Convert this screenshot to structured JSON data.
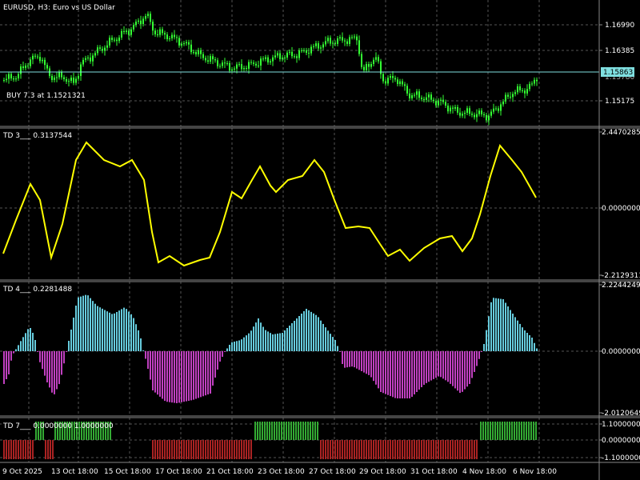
{
  "main": {
    "title": "EURUSD, H3:  Euro vs US Dollar",
    "trade_label": "BUY 7.3 at 1.1521321",
    "price_axis": [
      "1.16990",
      "1.16385",
      "1.15175"
    ],
    "current_price": "1.15863",
    "current_price_behind": "1.15780"
  },
  "td3": {
    "title": "TD 3___  0.3137544",
    "axis": [
      "2.4470285",
      "0.0000000",
      "-2.2129311"
    ]
  },
  "td4": {
    "title": "TD 4___  0.2281488",
    "axis": [
      "2.2244249",
      "0.0000000",
      "-2.0120649"
    ]
  },
  "td7": {
    "title": "TD 7___  0.0000000  1.0000000",
    "axis": [
      "1.1000000",
      "0.0000000",
      "-1.1000000"
    ]
  },
  "time_axis": [
    "9 Oct 2025",
    "13 Oct 18:00",
    "15 Oct 18:00",
    "17 Oct 18:00",
    "21 Oct 18:00",
    "23 Oct 18:00",
    "27 Oct 18:00",
    "29 Oct 18:00",
    "31 Oct 18:00",
    "4 Nov 18:00",
    "6 Nov 18:00"
  ],
  "colors": {
    "bull": "#33ff33",
    "bear": "#33ff33",
    "price_line": "#7fdfe0",
    "td3_line": "#ffff00",
    "td4_pos": "#66ccdd",
    "td4_neg": "#c040c0",
    "td7_pos": "#33aa33",
    "td7_neg": "#aa2222"
  }
}
